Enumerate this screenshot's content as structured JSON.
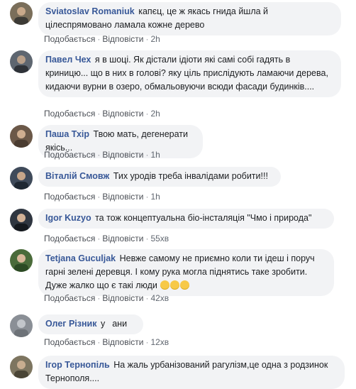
{
  "actions": {
    "like": "Подобається",
    "reply": "Відповісти"
  },
  "comments": [
    {
      "author": "Sviatoslav Romaniuk",
      "text": "капєц, це ж якась гнида йшла й цілеспрямовано ламала кожне дерево",
      "time": "2h",
      "avatar_color": "#7a6e5a"
    },
    {
      "author": "Павел Чех",
      "text": "я в шоці. Як дістали ідіоти які самі собі гадять в криницю... що в них в голові? яку ціль прислідують ламаючи дерева, кидаючи вурни в озеро, обмальовуючи всюди фасади будинків....",
      "time": "2h",
      "avatar_color": "#5e6670"
    },
    {
      "author": "Паша Тхір",
      "text": "Твою мать, дегенерати якісь...",
      "time": "1h",
      "avatar_color": "#6b5848"
    },
    {
      "author": "Віталій Смовж",
      "text": "Тих уродів треба інвалідами робити!!!",
      "time": "1h",
      "avatar_color": "#3f4a5a"
    },
    {
      "author": "Igor Kuzyo",
      "text": "та тож концептуальна біо-інсталяція \"Чмо і природа\"",
      "time": "55хв",
      "avatar_color": "#2f3640"
    },
    {
      "author": "Tetjana Guculjak",
      "text": "Невже самому не приємно коли ти ідеш і поруч гарні зелені деревця. І кому рука могла піднятись таке зробити. Дуже жалко що є такі люди",
      "time": "42хв",
      "avatar_color": "#4a6b3a",
      "emoji": "sad-face"
    },
    {
      "author": "Олег Різник",
      "text_before": "у",
      "text_after": "ани",
      "time": "12хв",
      "avatar_color": "#8a8f96"
    },
    {
      "author": "Ігор Тернопіль",
      "text": "На жаль урбанізований рагулізм,це одна з родзинок Тернополя....",
      "time": "",
      "avatar_color": "#7d7560"
    }
  ]
}
